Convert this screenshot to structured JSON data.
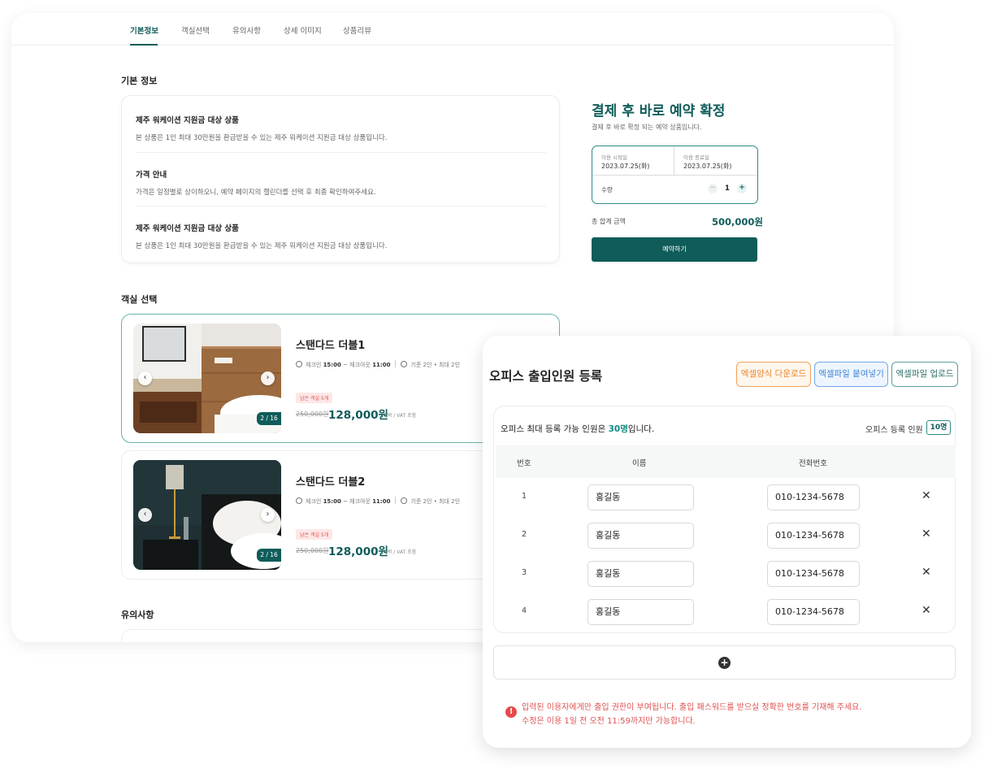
{
  "tabs": [
    "기본정보",
    "객실선택",
    "유의사항",
    "상세 이미지",
    "상품리뷰"
  ],
  "basic_info": {
    "section_title": "기본 정보",
    "items": [
      {
        "title": "제주 워케이션 지원금 대상 상품",
        "desc": "본 상품은 1인 최대 30만원을 환급받을 수 있는 제주 워케이션 지원금 대상 상품입니다."
      },
      {
        "title": "가격 안내",
        "desc": "가격은 일정별로 상이하오니, 예약 페이지의 캘린더를 선택 후 최종 확인하여주세요."
      },
      {
        "title": "제주 워케이션 지원금 대상 상품",
        "desc": "본 상품은 1인 최대 30만원을 환급받을 수 있는 제주 워케이션 지원금 대상 상품입니다."
      }
    ]
  },
  "booking": {
    "title": "결제 후 바로 예약 확정",
    "subtitle": "결제 후 바로 확정 되는 예약 상품입니다.",
    "start_label": "이용 시작일",
    "start_value": "2023.07.25(화)",
    "end_label": "이용 종료일",
    "end_value": "2023.07.25(화)",
    "qty_label": "수량",
    "qty_value": "1",
    "minus": "−",
    "plus": "+",
    "total_label": "총 합계 금액",
    "total_value": "500,000원",
    "reserve_label": "예약하기"
  },
  "rooms": {
    "section_title": "객실 선택",
    "list": [
      {
        "name": "스탠다드 더블1",
        "checkin_label": "체크인",
        "checkin": "15:00",
        "checkout_label": "~ 체크아웃",
        "checkout": "11:00",
        "guests": "기준 2인 • 최대 2인",
        "badge": "남은 객실 5개",
        "old_price": "250,000원",
        "price": "128,000원",
        "price_note": "1박 / VAT 포함",
        "counter": "2 / 16"
      },
      {
        "name": "스탠다드 더블2",
        "checkin_label": "체크인",
        "checkin": "15:00",
        "checkout_label": "~ 체크아웃",
        "checkout": "11:00",
        "guests": "기준 2인 • 최대 2인",
        "badge": "남은 객실 5개",
        "old_price": "250,000원",
        "price": "128,000원",
        "price_note": "1박 / VAT 포함",
        "counter": "2 / 16"
      }
    ]
  },
  "notice": {
    "section_title": "유의사항"
  },
  "modal": {
    "title": "오피스 출입인원 등록",
    "btn_download": "엑셀양식 다운로드",
    "btn_paste": "엑셀파일 붙여넣기",
    "btn_upload": "엑셀파일 업로드",
    "capacity_prefix": "오피스 최대 등록 가능 인원은 ",
    "capacity_value": "30명",
    "capacity_suffix": "입니다.",
    "registered_label": "오피스 등록 인원",
    "registered_value": "10명",
    "col_no": "번호",
    "col_name": "이름",
    "col_phone": "전화번호",
    "rows": [
      {
        "no": "1",
        "name": "홍길동",
        "phone": "010-1234-5678"
      },
      {
        "no": "2",
        "name": "홍길동",
        "phone": "010-1234-5678"
      },
      {
        "no": "3",
        "name": "홍길동",
        "phone": "010-1234-5678"
      },
      {
        "no": "4",
        "name": "홍길동",
        "phone": "010-1234-5678"
      }
    ],
    "warning_line1": "입력된 이용자에게만 출입 권한이 부여됩니다. 출입 패스워드를 받으실 정확한 번호를 기재해 주세요.",
    "warning_line2": "수정은 이용 1일 전 오전 11:59까지만 가능합니다."
  },
  "colors": {
    "primary": "#0f5c5a",
    "accent_teal": "#0f8a84",
    "warning": "#e05252",
    "orange": "#e8872e",
    "blue": "#3f84d8"
  }
}
